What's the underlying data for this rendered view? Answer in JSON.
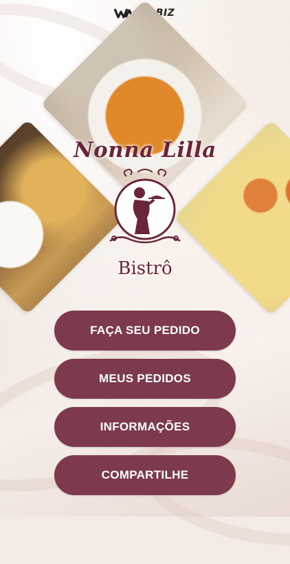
{
  "brand": {
    "name": "WABIZ",
    "icon": "wabiz-logo-icon"
  },
  "logo": {
    "title": "Nonna Lilla",
    "subtitle": "Bistrô"
  },
  "images": [
    {
      "name": "pasta-photo",
      "description": "penne pasta bowl"
    },
    {
      "name": "burrata-fries-photo",
      "description": "burrata with fries"
    },
    {
      "name": "risotto-shrimp-photo",
      "description": "risotto with shrimp"
    }
  ],
  "menu": {
    "items": [
      {
        "label": "FAÇA SEU PEDIDO"
      },
      {
        "label": "MEUS PEDIDOS"
      },
      {
        "label": "INFORMAÇÕES"
      },
      {
        "label": "COMPARTILHE"
      }
    ]
  },
  "colors": {
    "accent": "#7d3a4d",
    "logo": "#6a2538",
    "button_text": "#ffffff",
    "background": "#f5ebe6"
  }
}
